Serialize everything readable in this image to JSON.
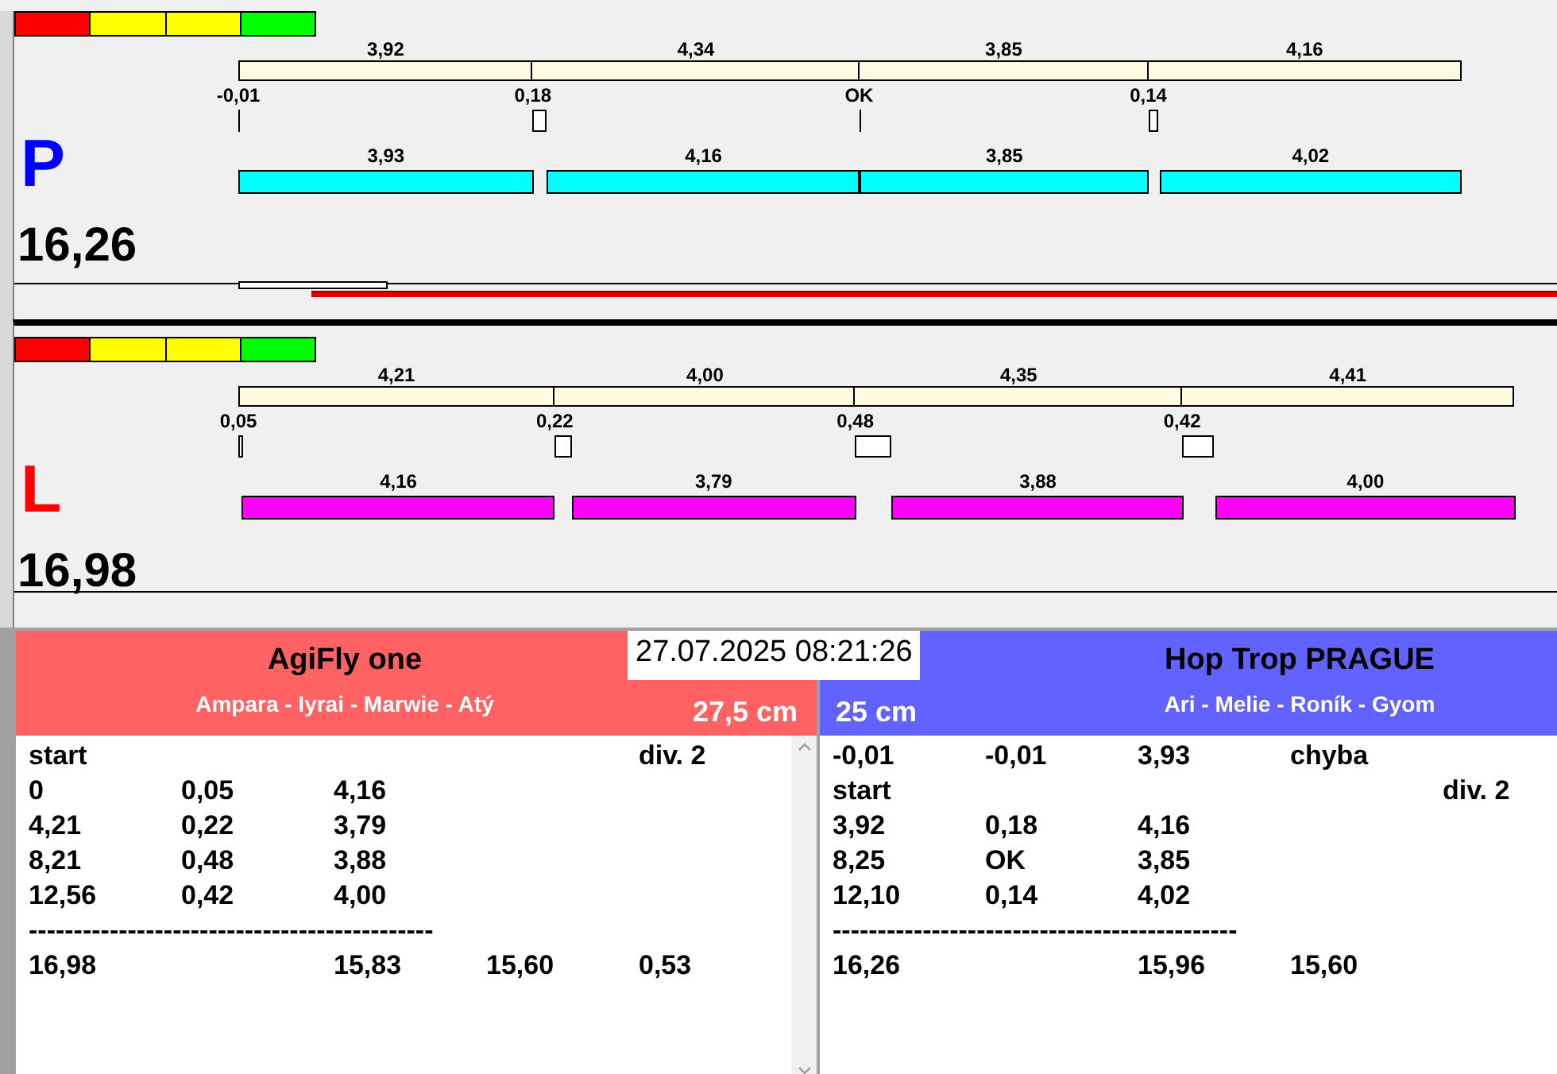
{
  "lanes": [
    {
      "letter": "P",
      "color": "#00ffff",
      "kind": "blue_team",
      "total": "16,26",
      "run_indicator": true,
      "splits": [
        "3,92",
        "4,34",
        "3,85",
        "4,16"
      ],
      "reactions": [
        "-0,01",
        "0,18",
        "OK",
        "0,14"
      ],
      "runs": [
        "3,93",
        "4,16",
        "3,85",
        "4,02"
      ]
    },
    {
      "letter": "L",
      "color": "#ff00ff",
      "kind": "red_team",
      "total": "16,98",
      "run_indicator": false,
      "splits": [
        "4,21",
        "4,00",
        "4,35",
        "4,41"
      ],
      "reactions": [
        "0,05",
        "0,22",
        "0,48",
        "0,42"
      ],
      "runs": [
        "4,16",
        "3,79",
        "3,88",
        "4,00"
      ]
    }
  ],
  "timestamp": "27.07.2025 08:21:26",
  "teams": [
    {
      "name": "AgiFly one",
      "dogs": "Ampara - Iyrai - Marwie - Atý",
      "height": "27,5 cm",
      "color": "#ff6262",
      "rows": [
        {
          "kind": "cells",
          "cells": [
            "start",
            null,
            null,
            null,
            "div. 2"
          ]
        },
        {
          "kind": "cells",
          "cells": [
            "0",
            "0,05",
            "4,16",
            null,
            null
          ]
        },
        {
          "kind": "cells",
          "cells": [
            "4,21",
            "0,22",
            "3,79",
            null,
            null
          ]
        },
        {
          "kind": "cells",
          "cells": [
            "8,21",
            "0,48",
            "3,88",
            null,
            null
          ]
        },
        {
          "kind": "cells",
          "cells": [
            "12,56",
            "0,42",
            "4,00",
            null,
            null
          ]
        },
        {
          "kind": "rule",
          "text": "---------------------------------------------"
        },
        {
          "kind": "cells",
          "cells": [
            "16,98",
            null,
            "15,83",
            "15,60",
            "0,53"
          ]
        }
      ]
    },
    {
      "name": "Hop Trop PRAGUE",
      "dogs": "Ari - Melie - Roník - Gyom",
      "height": "25 cm",
      "color": "#6262ff",
      "rows": [
        {
          "kind": "cells",
          "cells": [
            "-0,01",
            "-0,01",
            "3,93",
            "chyba",
            null
          ]
        },
        {
          "kind": "cells",
          "cells": [
            "start",
            null,
            null,
            null,
            "div. 2"
          ]
        },
        {
          "kind": "cells",
          "cells": [
            "3,92",
            "0,18",
            "4,16",
            null,
            null
          ]
        },
        {
          "kind": "cells",
          "cells": [
            "8,25",
            "OK",
            "3,85",
            null,
            null
          ]
        },
        {
          "kind": "cells",
          "cells": [
            "12,10",
            "0,14",
            "4,02",
            null,
            null
          ]
        },
        {
          "kind": "rule",
          "text": "---------------------------------------------"
        },
        {
          "kind": "cells",
          "cells": [
            "16,26",
            null,
            "15,96",
            "15,60",
            null
          ]
        }
      ]
    }
  ]
}
